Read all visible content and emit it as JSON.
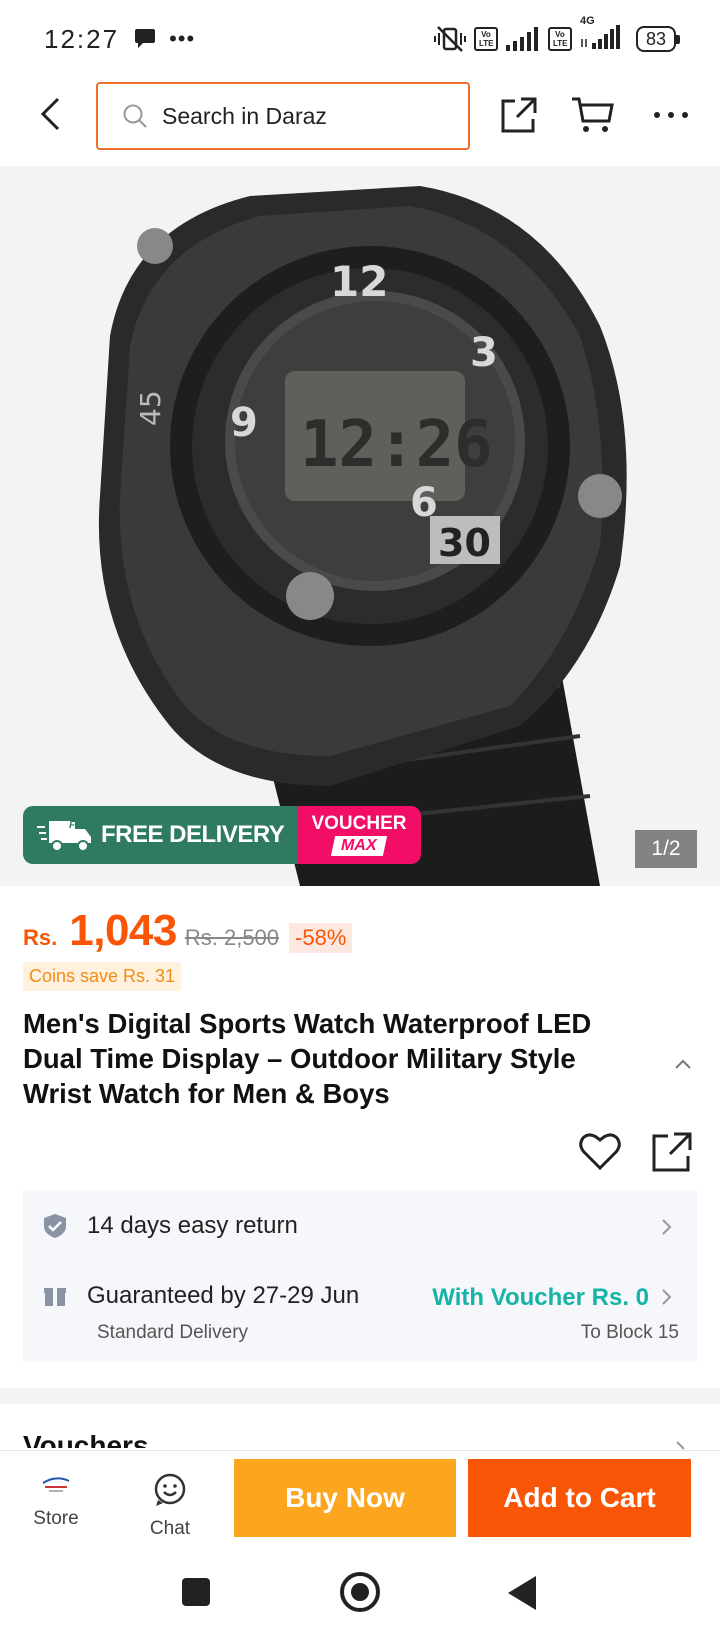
{
  "status_bar": {
    "time": "12:27",
    "lte1": "Vo LTE",
    "lte2": "Vo LTE",
    "network": "4G",
    "battery": "83"
  },
  "header": {
    "search_placeholder": "Search in Daraz",
    "icons": [
      "back-arrow-icon",
      "search-icon",
      "share-icon",
      "cart-icon",
      "more-icon"
    ]
  },
  "product": {
    "image_counter": "1/2",
    "promo": {
      "free_badge": "FREE",
      "free_delivery": "FREE DELIVERY",
      "voucher": "VOUCHER",
      "max": "MAX"
    },
    "price_currency": "Rs.",
    "price": "1,043",
    "original_price": "Rs. 2,500",
    "discount": "-58%",
    "coins": "Coins save Rs. 31",
    "title": "Men's Digital Sports Watch Waterproof LED Dual Time Display – Outdoor Military Style Wrist Watch for Men & Boys"
  },
  "info": {
    "return": "14 days easy return",
    "delivery": "Guaranteed by 27-29 Jun",
    "voucher": "With Voucher Rs. 0",
    "delivery_type": "Standard Delivery",
    "location": "To Block 15"
  },
  "vouchers_title": "Vouchers",
  "action_bar": {
    "store": "Store",
    "chat": "Chat",
    "buy_now": "Buy Now",
    "add_to_cart": "Add to Cart"
  },
  "colors": {
    "accent_orange": "#f85606",
    "buy_now": "#fca620",
    "teal": "#17b3a6",
    "promo_green": "#2f7a63",
    "promo_pink": "#f20d67"
  }
}
